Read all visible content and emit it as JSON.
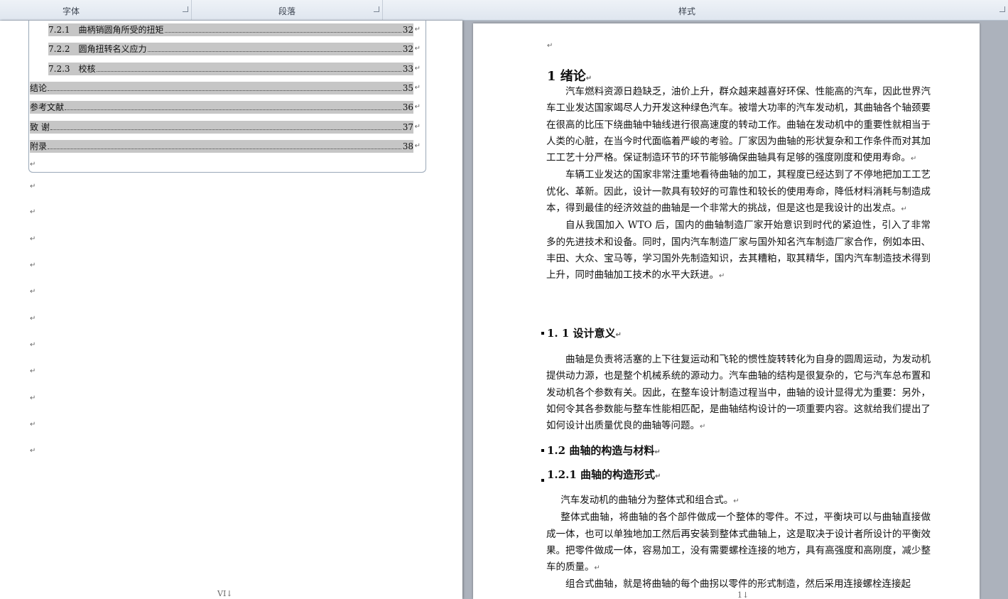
{
  "ribbon": {
    "font_group": "字体",
    "paragraph_group": "段落",
    "styles_group": "样式"
  },
  "toc": [
    {
      "text": "7.2.1　曲柄销圆角所受的扭矩",
      "page": "32"
    },
    {
      "text": "7.2.2　圆角扭转名义应力",
      "page": "32"
    },
    {
      "text": "7.2.3　校核",
      "page": "33"
    },
    {
      "text": "结论",
      "page": "35"
    },
    {
      "text": "参考文献",
      "page": "36"
    },
    {
      "text": "致  谢",
      "page": "37"
    },
    {
      "text": "附录",
      "page": "38"
    }
  ],
  "marks": {
    "return": "↵"
  },
  "left_footer": "VI↓",
  "right_footer": "1↓",
  "content": {
    "h_intro": "1 绪论",
    "intro_p1": "汽车燃料资源日趋缺乏，油价上升，群众越来越喜好环保、性能高的汽车，因此世界汽车工业发达国家竭尽人力开发这种绿色汽车。被增大功率的汽车发动机，其曲轴各个轴颈要在很高的比压下绕曲轴中轴线进行很高速度的转动工作。曲轴在发动机中的重要性就相当于人类的心脏，在当今时代面临着严峻的考验。厂家因为曲轴的形状复杂和工作条件而对其加工工艺十分严格。保证制造环节的环节能够确保曲轴具有足够的强度刚度和使用寿命。",
    "intro_p2": "车辆工业发达的国家非常注重地看待曲轴的加工，其程度已经达到了不停地把加工工艺优化、革新。因此，设计一款具有较好的可靠性和较长的使用寿命，降低材料消耗与制造成本，得到最佳的经济效益的曲轴是一个非常大的挑战，但是这也是我设计的出发点。",
    "intro_p3": "自从我国加入 WTO 后，国内的曲轴制造厂家开始意识到时代的紧迫性，引入了非常多的先进技术和设备。同时，国内汽车制造厂家与国外知名汽车制造厂家合作，例如本田、丰田、大众、宝马等，学习国外先制造知识，去其糟粕，取其精华，国内汽车制造技术得到上升，同时曲轴加工技术的水平大跃进。",
    "h_1_1": "1. 1 设计意义",
    "p_1_1": "曲轴是负责将活塞的上下往复运动和飞轮的惯性旋转转化为自身的圆周运动，为发动机提供动力源，也是整个机械系统的源动力。汽车曲轴的结构是很复杂的，它与汽车总布置和发动机各个参数有关。因此，在整车设计制造过程当中，曲轴的设计显得尤为重要：另外，如何令其各参数能与整车性能相匹配，是曲轴结构设计的一项重要内容。这就给我们提出了如何设计出质量优良的曲轴等问题。",
    "h_1_2": "1.2 曲轴的构造与材料",
    "h_1_2_1": "1.2.1 曲轴的构造形式",
    "p_a": "汽车发动机的曲轴分为整体式和组合式。",
    "p_b": "整体式曲轴，将曲轴的各个部件做成一个整体的零件。不过，平衡块可以与曲轴直接做成一体，也可以单独地加工然后再安装到整体式曲轴上，这是取决于设计者所设计的平衡效果。把零件做成一体，容易加工，没有需要螺栓连接的地方，具有高强度和高刚度，减少整车的质量。",
    "p_c": "组合式曲轴，就是将曲轴的每个曲拐以零件的形式制造，然后采用连接螺栓连接起"
  }
}
